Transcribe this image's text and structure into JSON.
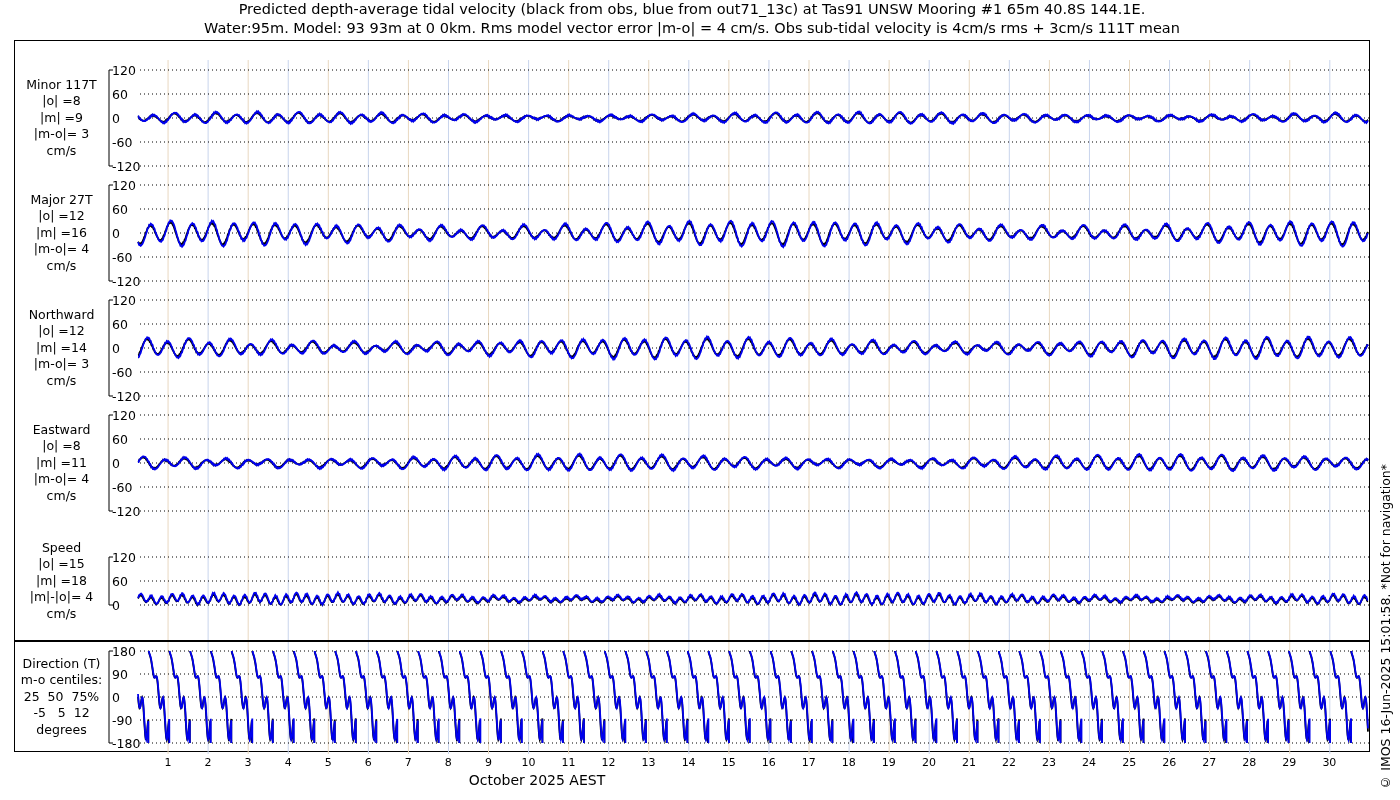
{
  "title": [
    "Predicted depth-average tidal velocity (black from obs, blue from out71_13c) at Tas91 UNSW Mooring #1 65m 40.8S 144.1E.",
    "Water:95m. Model: 93 93m at 0 0km. Rms model vector error |m-o| = 4 cm/s. Obs sub-tidal velocity is 4cm/s rms + 3cm/s 111T mean"
  ],
  "panels": [
    {
      "kind": "velocity",
      "label": [
        "Minor 117T",
        "|o| =8",
        "|m| =9",
        "|m-o|= 3",
        "cm/s"
      ],
      "yticks": [
        "120",
        "60",
        "0",
        "-60",
        "-120"
      ]
    },
    {
      "kind": "velocity",
      "label": [
        "Major 27T",
        "|o| =12",
        "|m| =16",
        "|m-o|= 4",
        "cm/s"
      ],
      "yticks": [
        "120",
        "60",
        "0",
        "-60",
        "-120"
      ]
    },
    {
      "kind": "velocity",
      "label": [
        "Northward",
        "|o| =12",
        "|m| =14",
        "|m-o|= 3",
        "cm/s"
      ],
      "yticks": [
        "120",
        "60",
        "0",
        "-60",
        "-120"
      ]
    },
    {
      "kind": "velocity",
      "label": [
        "Eastward",
        "|o| =8",
        "|m| =11",
        "|m-o|= 4",
        "cm/s"
      ],
      "yticks": [
        "120",
        "60",
        "0",
        "-60",
        "-120"
      ]
    },
    {
      "kind": "speed",
      "label": [
        "Speed",
        "|o| =15",
        "|m| =18",
        "|m|-|o|= 4",
        "cm/s"
      ],
      "yticks": [
        "120",
        "60",
        "0"
      ]
    },
    {
      "kind": "direction",
      "label": [
        "Direction (T)",
        "m-o centiles:",
        "25  50  75%",
        "-5   5  12",
        "degrees"
      ],
      "yticks": [
        "180",
        "90",
        "0",
        "-90",
        "-180"
      ]
    }
  ],
  "days": [
    "1",
    "2",
    "3",
    "4",
    "5",
    "6",
    "7",
    "8",
    "9",
    "10",
    "11",
    "12",
    "13",
    "14",
    "15",
    "16",
    "17",
    "18",
    "19",
    "20",
    "21",
    "22",
    "23",
    "24",
    "25",
    "26",
    "27",
    "28",
    "29",
    "30"
  ],
  "xlabel": "October 2025 AEST",
  "credit": "© IMOS 16-Jun-2025 15:01:58. *Not for navigation*"
}
